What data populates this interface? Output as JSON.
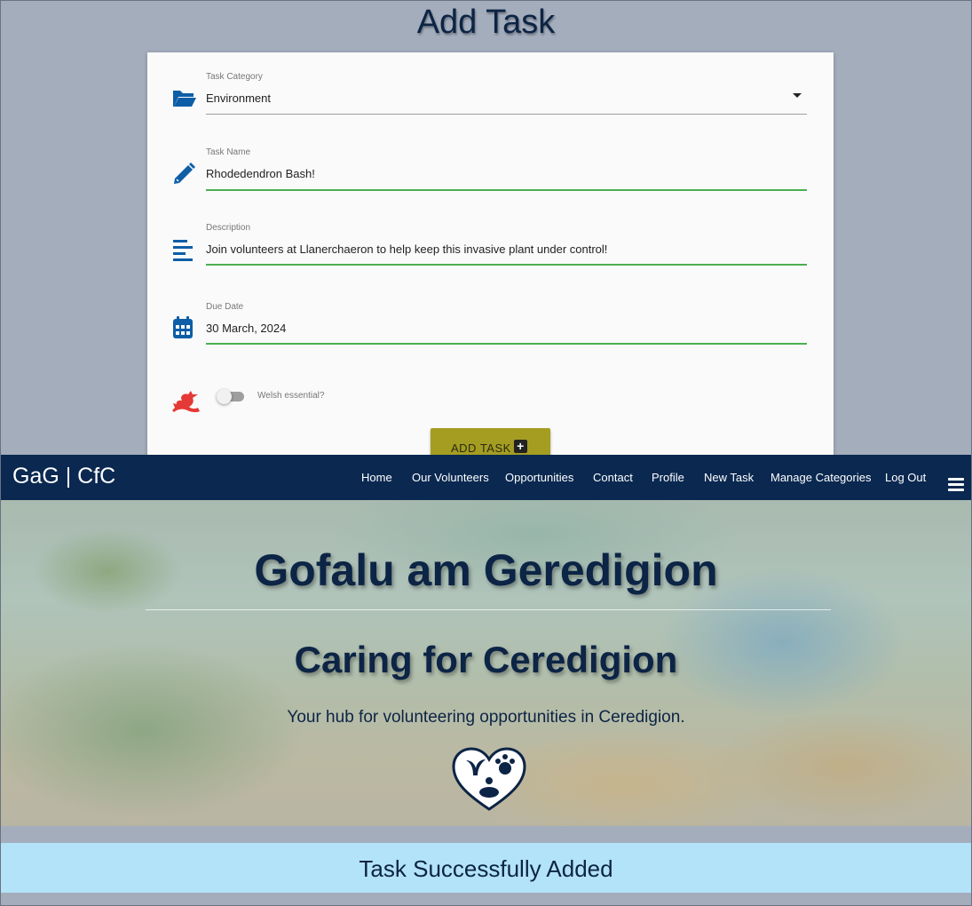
{
  "page": {
    "title": "Add Task"
  },
  "form": {
    "category": {
      "label": "Task Category",
      "value": "Environment"
    },
    "name": {
      "label": "Task Name",
      "value": "Rhodedendron Bash!"
    },
    "description": {
      "label": "Description",
      "value": "Join volunteers at Llanerchaeron to help keep this invasive plant under control!"
    },
    "due_date": {
      "label": "Due Date",
      "value": "30 March, 2024"
    },
    "welsh": {
      "label": "Welsh essential?",
      "checked": false
    },
    "submit_label": "ADD TASK",
    "submit_icon": "+"
  },
  "navbar": {
    "brand": "GaG | CfC",
    "links": [
      "Home",
      "Our Volunteers",
      "Opportunities",
      "Contact",
      "Profile",
      "New Task",
      "Manage Categories",
      "Log Out"
    ]
  },
  "hero": {
    "title_welsh": "Gofalu am Geredigion",
    "title_english": "Caring for Ceredigion",
    "subtitle": "Your hub for volunteering opportunities in Ceredigion."
  },
  "toast": {
    "message": "Task Successfully Added"
  },
  "colors": {
    "primary": "#0a2850",
    "icon_blue": "#0d5ea6",
    "dragon_red": "#e53935",
    "valid_green": "#4caf50",
    "button_olive": "#a59d22",
    "toast_bg": "#b3e3f8"
  },
  "icons": {
    "category": "folder-open-icon",
    "name": "pencil-icon",
    "description": "text-lines-icon",
    "due_date": "calendar-icon",
    "welsh": "welsh-dragon-icon",
    "menu": "hamburger-menu-icon",
    "logo": "heart-logo-icon"
  }
}
